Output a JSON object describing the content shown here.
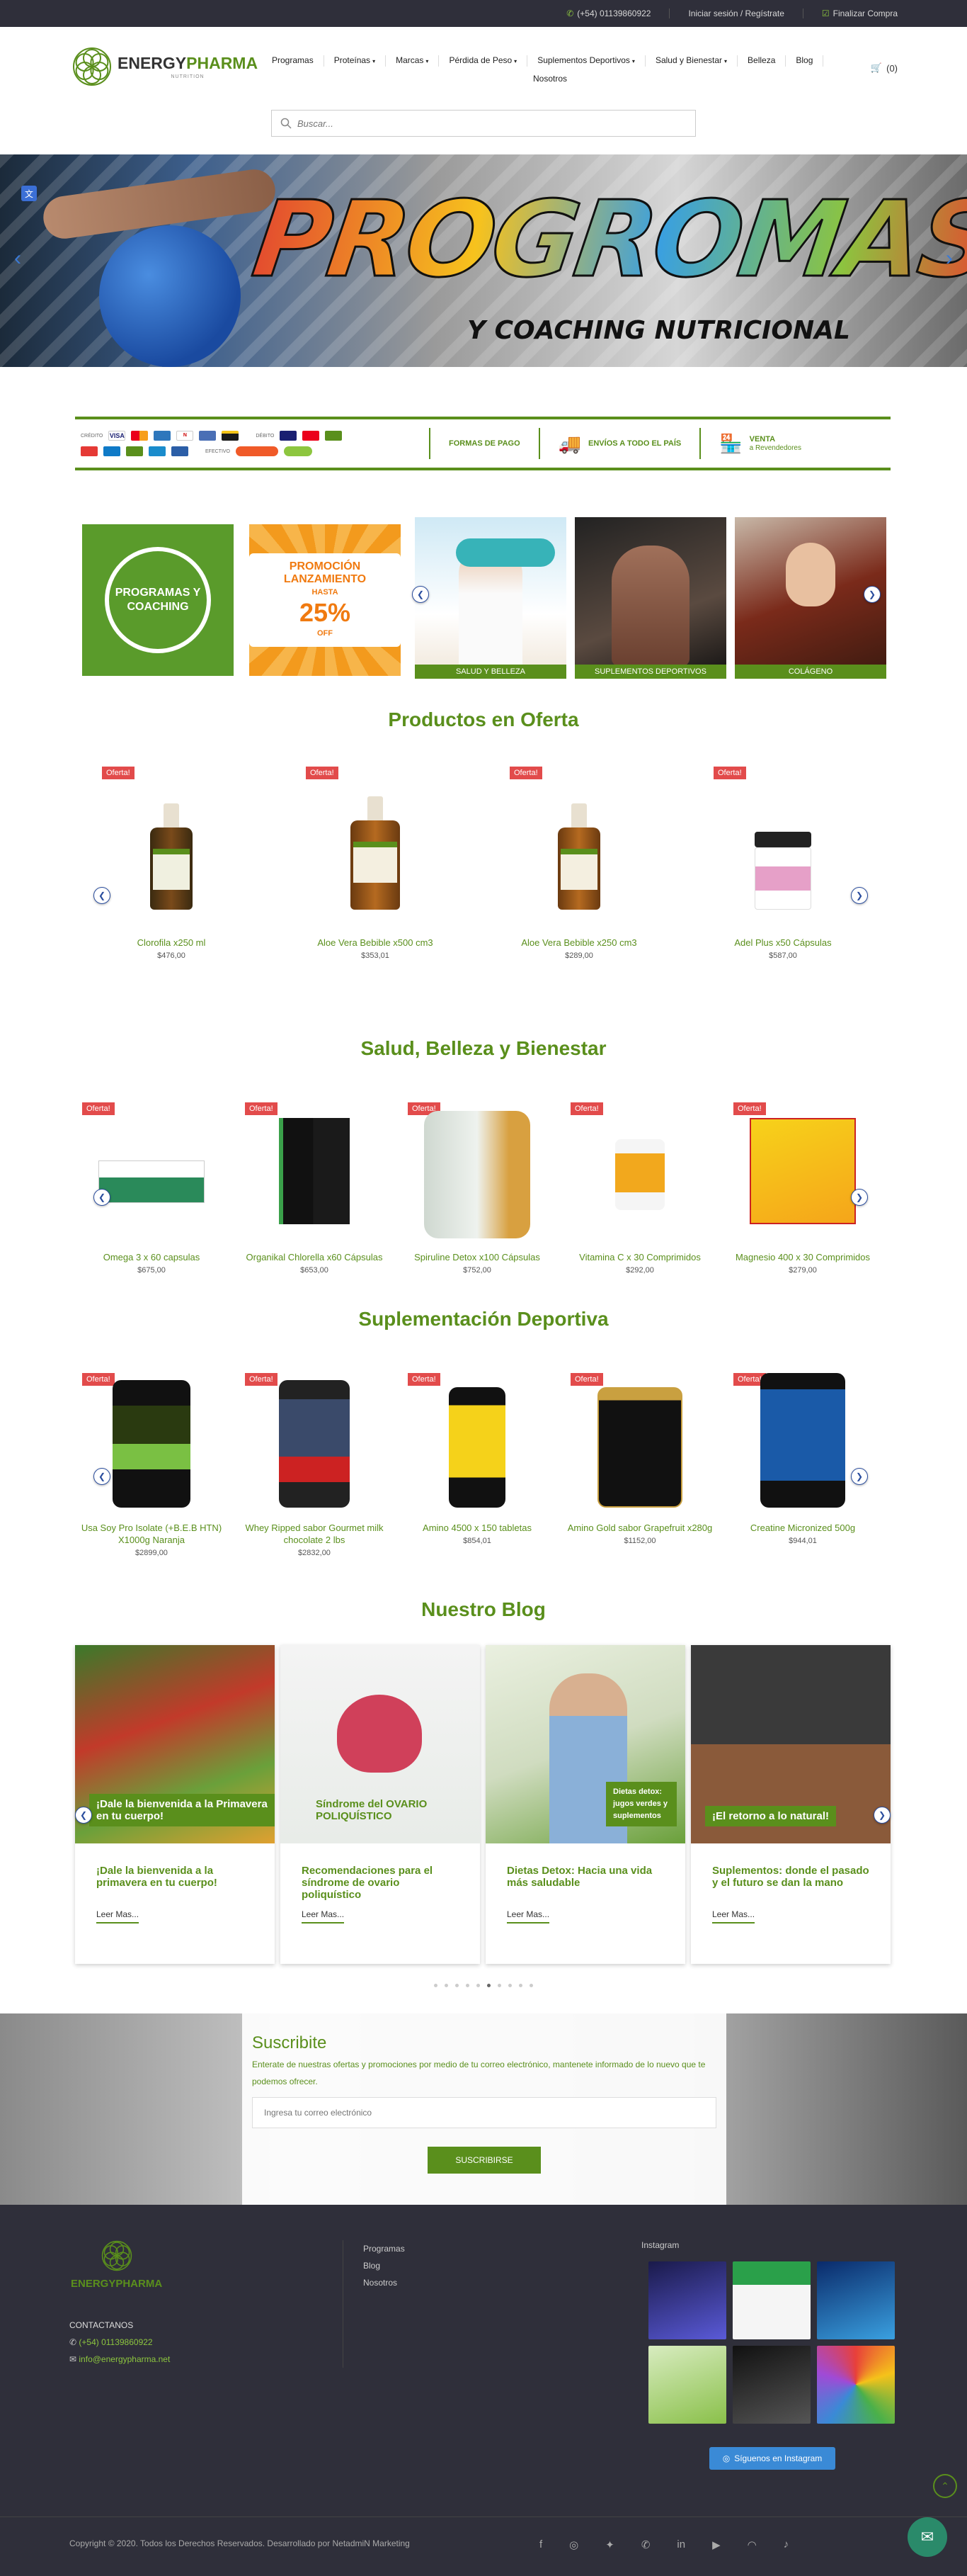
{
  "topbar": {
    "phone": "(+54) 01139860922",
    "login": "Iniciar sesión / Regístrate",
    "checkout": "Finalizar Compra"
  },
  "brand": {
    "name_a": "ENERGY",
    "name_b": "PHARMA",
    "tagline": "NUTRITION"
  },
  "nav": [
    {
      "label": "Programas",
      "caret": false
    },
    {
      "label": "Proteínas",
      "caret": true
    },
    {
      "label": "Marcas",
      "caret": true
    },
    {
      "label": "Pérdida de Peso",
      "caret": true
    },
    {
      "label": "Suplementos Deportivos",
      "caret": true
    },
    {
      "label": "Salud y Bienestar",
      "caret": true
    },
    {
      "label": "Belleza",
      "caret": false
    },
    {
      "label": "Blog",
      "caret": false
    },
    {
      "label": "Nosotros",
      "caret": false
    }
  ],
  "cart": {
    "count": "(0)"
  },
  "search": {
    "placeholder": "Buscar..."
  },
  "hero": {
    "title": "PROGROMAS",
    "subtitle": "Y COACHING NUTRICIONAL"
  },
  "payments": {
    "credito": "CRÉDITO",
    "debito": "DÉBITO",
    "efectivo": "EFECTIVO",
    "formas": "FORMAS DE PAGO",
    "envios": "ENVÍOS A TODO EL PAÍS",
    "venta": "VENTA",
    "revendedores": "a Revendedores"
  },
  "categories": {
    "programas": "PROGRAMAS Y COACHING",
    "promo_a": "PROMOCIÓN LANZAMIENTO",
    "promo_b": "HASTA",
    "promo_c": "25%",
    "promo_d": "OFF",
    "salud": "SALUD Y BELLEZA",
    "deportivos": "SUPLEMENTOS DEPORTIVOS",
    "colageno": "COLÁGENO"
  },
  "sections": {
    "ofertas": "Productos en Oferta",
    "salud": "Salud, Belleza y Bienestar",
    "deportiva": "Suplementación Deportiva",
    "blog": "Nuestro Blog"
  },
  "badge": "Oferta!",
  "ofertas": [
    {
      "name": "Clorofila x250 ml",
      "price": "$476,00"
    },
    {
      "name": "Aloe Vera Bebible x500 cm3",
      "price": "$353,01"
    },
    {
      "name": "Aloe Vera Bebible x250 cm3",
      "price": "$289,00"
    },
    {
      "name": "Adel Plus x50 Cápsulas",
      "price": "$587,00"
    }
  ],
  "salud": [
    {
      "name": "Omega 3 x 60 capsulas",
      "price": "$675,00"
    },
    {
      "name": "Organikal Chlorella x60 Cápsulas",
      "price": "$653,00"
    },
    {
      "name": "Spiruline Detox x100 Cápsulas",
      "price": "$752,00"
    },
    {
      "name": "Vitamina C x 30 Comprimidos",
      "price": "$292,00"
    },
    {
      "name": "Magnesio 400 x 30 Comprimidos",
      "price": "$279,00"
    }
  ],
  "deportiva": [
    {
      "name": "Usa Soy Pro Isolate (+B.E.B HTN) X1000g Naranja",
      "price": "$2899,00"
    },
    {
      "name": "Whey Ripped sabor Gourmet milk chocolate 2 lbs",
      "price": "$2832,00"
    },
    {
      "name": "Amino 4500 x 150 tabletas",
      "price": "$854,01"
    },
    {
      "name": "Amino Gold sabor Grapefruit x280g",
      "price": "$1152,00"
    },
    {
      "name": "Creatine Micronized 500g",
      "price": "$944,01"
    }
  ],
  "blog": [
    {
      "img_caption": "¡Dale la bienvenida a la Primavera en tu cuerpo!",
      "title": "¡Dale la bienvenida a la primavera en tu cuerpo!",
      "more": "Leer Mas..."
    },
    {
      "img_caption": "Síndrome del OVARIO POLIQUÍSTICO",
      "title": "Recomendaciones para el síndrome de ovario poliquístico",
      "more": "Leer Mas..."
    },
    {
      "img_caption": "Dietas detox: jugos verdes y suplementos",
      "title": "Dietas Detox: Hacia una vida más saludable",
      "more": "Leer Mas..."
    },
    {
      "img_caption": "¡El retorno a lo natural!",
      "title": "Suplementos: donde el pasado y el futuro se dan la mano",
      "more": "Leer Mas..."
    }
  ],
  "subscribe": {
    "title": "Suscribite",
    "text": "Enterate de nuestras ofertas y promociones por medio de tu correo electrónico, mantenete informado de lo nuevo que te podemos ofrecer.",
    "placeholder": "Ingresa tu correo electrónico",
    "button": "SUSCRIBIRSE"
  },
  "footer": {
    "brand": "ENERGYPHARMA",
    "contact_head": "CONTACTANOS",
    "phone": "(+54) 01139860922",
    "email": "info@energypharma.net",
    "links": [
      "Programas",
      "Blog",
      "Nosotros"
    ],
    "instagram_head": "Instagram",
    "instagram_button": "Síguenos en Instagram",
    "copyright": "Copyright © 2020. Todos los Derechos Reservados.   Desarrollado por NetadmiN Marketing"
  },
  "colors": {
    "accent": "#5a8f1c",
    "badge": "#e24b4b",
    "footer": "#2f2f3a"
  }
}
